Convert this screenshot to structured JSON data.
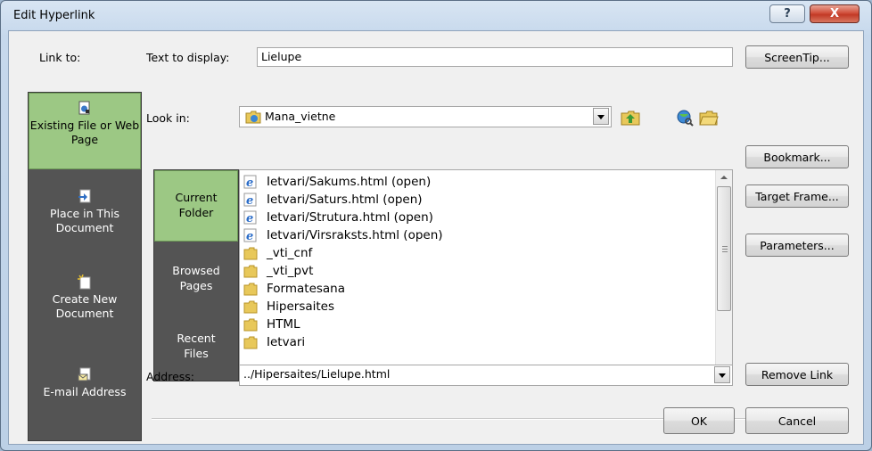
{
  "window": {
    "title": "Edit Hyperlink",
    "help_label": "?",
    "close_label": "X"
  },
  "link_to": {
    "label": "Link to:",
    "items": [
      {
        "label": "Existing File or Web Page",
        "active": true,
        "icon": "existing-file-icon"
      },
      {
        "label": "Place in This Document",
        "active": false,
        "icon": "place-in-document-icon"
      },
      {
        "label": "Create New Document",
        "active": false,
        "icon": "new-document-icon"
      },
      {
        "label": "E-mail Address",
        "active": false,
        "icon": "email-icon"
      }
    ]
  },
  "text_to_display": {
    "label": "Text to display:",
    "value": "Lielupe"
  },
  "look_in": {
    "label": "Look in:",
    "value": "Mana_vietne",
    "folder_icon": "web-folder-icon"
  },
  "toolbar_icons": [
    "up-one-folder-icon",
    "browse-web-icon",
    "browse-file-icon"
  ],
  "browse_tabs": [
    {
      "label_line1": "Current",
      "label_line2": "Folder",
      "active": true
    },
    {
      "label_line1": "Browsed",
      "label_line2": "Pages",
      "active": false
    },
    {
      "label_line1": "Recent",
      "label_line2": "Files",
      "active": false
    }
  ],
  "files": [
    {
      "name": "Ietvari/Sakums.html (open)",
      "type": "ie-page-icon"
    },
    {
      "name": "Ietvari/Saturs.html (open)",
      "type": "ie-page-icon"
    },
    {
      "name": "Ietvari/Strutura.html (open)",
      "type": "ie-page-icon"
    },
    {
      "name": "Ietvari/Virsraksts.html (open)",
      "type": "ie-page-icon"
    },
    {
      "name": "_vti_cnf",
      "type": "folder-icon"
    },
    {
      "name": "_vti_pvt",
      "type": "folder-icon"
    },
    {
      "name": "Formatesana",
      "type": "folder-icon"
    },
    {
      "name": "Hipersaites",
      "type": "folder-icon"
    },
    {
      "name": "HTML",
      "type": "folder-icon"
    },
    {
      "name": "Ietvari",
      "type": "folder-icon"
    }
  ],
  "address": {
    "label": "Address:",
    "value": "../Hipersaites/Lielupe.html"
  },
  "buttons": {
    "screentip": "ScreenTip...",
    "bookmark": "Bookmark...",
    "target_frame": "Target Frame...",
    "parameters": "Parameters...",
    "remove_link": "Remove Link",
    "ok": "OK",
    "cancel": "Cancel"
  },
  "colors": {
    "active_green": "#9cc884",
    "sidebar_dark": "#545454",
    "title_bar": "#c6d8ec",
    "close_red": "#c23a26"
  }
}
